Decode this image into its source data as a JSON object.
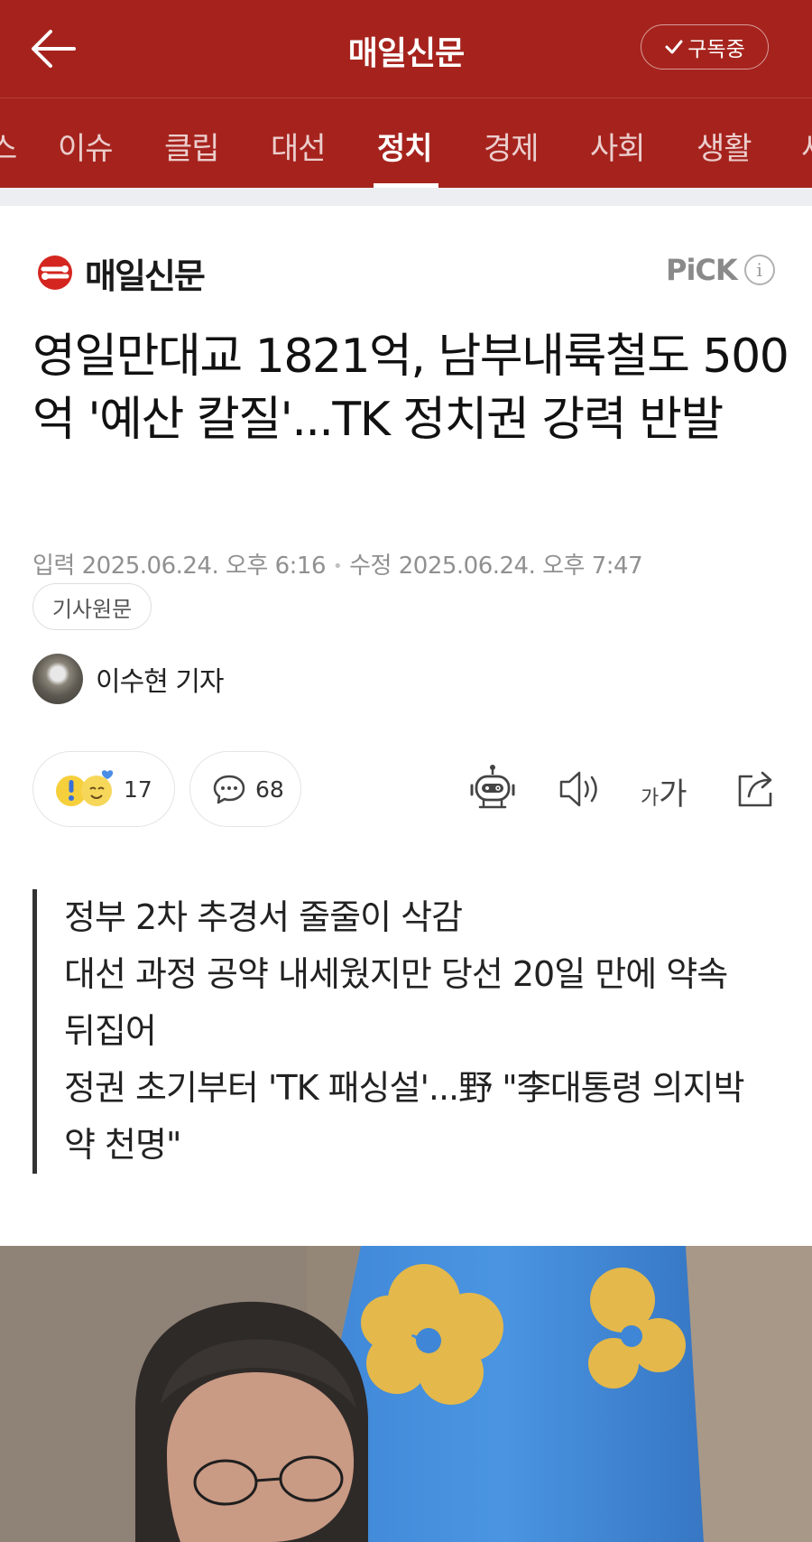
{
  "header": {
    "app_title": "매일신문",
    "subscribe_label": "구독중",
    "background_color": "#a6231d"
  },
  "tabs": [
    {
      "label": "스",
      "active": false
    },
    {
      "label": "이슈",
      "active": false
    },
    {
      "label": "클립",
      "active": false
    },
    {
      "label": "대선",
      "active": false
    },
    {
      "label": "정치",
      "active": true
    },
    {
      "label": "경제",
      "active": false
    },
    {
      "label": "사회",
      "active": false
    },
    {
      "label": "생활",
      "active": false
    },
    {
      "label": "세",
      "active": false
    }
  ],
  "article": {
    "press_name": "매일신문",
    "pick_label": "PiCK",
    "info_icon_label": "i",
    "headline": "영일만대교 1821억, 남부내륙철도 500억 '예산 칼질'...TK 정치권 강력 반발",
    "input_date": "입력 2025.06.24. 오후 6:16",
    "edit_date": "수정 2025.06.24. 오후 7:47",
    "original_label": "기사원문",
    "reporter": "이수현 기자",
    "reaction_count": "17",
    "comment_count": "68",
    "font_size_label_small": "가",
    "font_size_label_large": "가",
    "summary": [
      "정부 2차 추경서 줄줄이 삭감",
      "대선 과정 공약 내세웠지만 당선 20일 만에 약속",
      "뒤집어",
      "정권 초기부터 'TK 패싱설'...野 \"李대통령 의지박",
      "약 천명\""
    ]
  },
  "icons": [
    "back-arrow-icon",
    "check-icon",
    "press-logo-icon",
    "info-icon",
    "reaction-emoji-icon",
    "comment-icon",
    "robot-summary-icon",
    "speaker-icon",
    "font-size-icon",
    "share-icon"
  ]
}
